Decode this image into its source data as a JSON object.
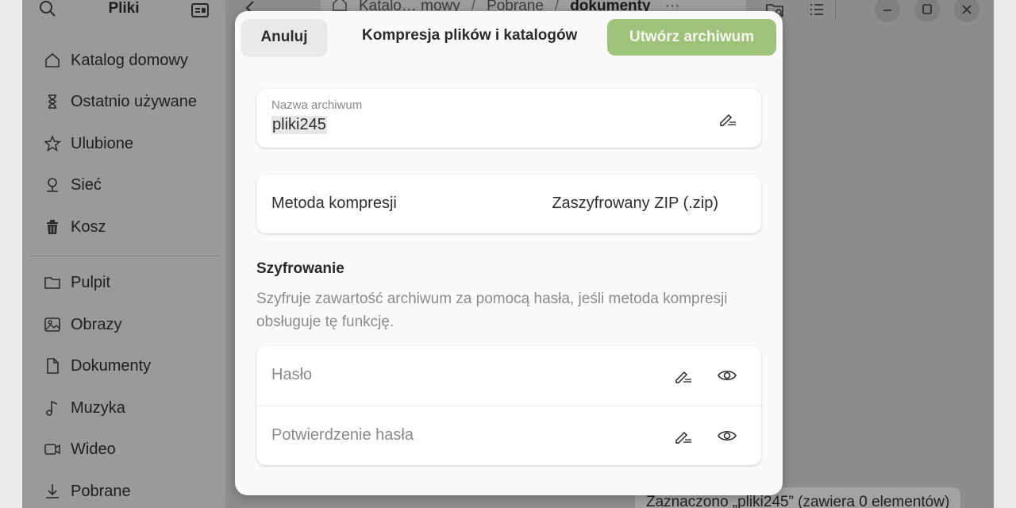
{
  "window": {
    "title": "Pliki",
    "status": "Zaznaczono „pliki245” (zawiera 0 elementów)"
  },
  "sidebar": {
    "items": [
      {
        "label": "Katalog domowy",
        "icon": "home-icon"
      },
      {
        "label": "Ostatnio używane",
        "icon": "hourglass-icon"
      },
      {
        "label": "Ulubione",
        "icon": "star-icon"
      },
      {
        "label": "Sieć",
        "icon": "network-icon"
      },
      {
        "label": "Kosz",
        "icon": "trash-icon"
      },
      {
        "label": "Pulpit",
        "icon": "folder-icon"
      },
      {
        "label": "Obrazy",
        "icon": "image-icon"
      },
      {
        "label": "Dokumenty",
        "icon": "document-icon"
      },
      {
        "label": "Muzyka",
        "icon": "music-icon"
      },
      {
        "label": "Wideo",
        "icon": "video-icon"
      },
      {
        "label": "Pobrane",
        "icon": "download-icon"
      }
    ]
  },
  "pathbar": {
    "segments": [
      "Katalo… mowy",
      "Pobrane",
      "dokumenty"
    ]
  },
  "dialog": {
    "cancel_label": "Anuluj",
    "title": "Kompresja plików i katalogów",
    "create_label": "Utwórz archiwum",
    "name_label": "Nazwa archiwum",
    "name_value": "pliki245",
    "method_label": "Metoda kompresji",
    "method_value": "Zaszyfrowany ZIP (.zip)",
    "encryption_title": "Szyfrowanie",
    "encryption_desc": "Szyfruje zawartość archiwum za pomocą hasła, jeśli metoda kompresji obsługuje tę funkcję.",
    "password_placeholder": "Hasło",
    "confirm_placeholder": "Potwierdzenie hasła"
  },
  "colors": {
    "accent": "#9ec27a",
    "dialog_bg": "#fafafa",
    "backdrop": "#8d8d8d"
  }
}
